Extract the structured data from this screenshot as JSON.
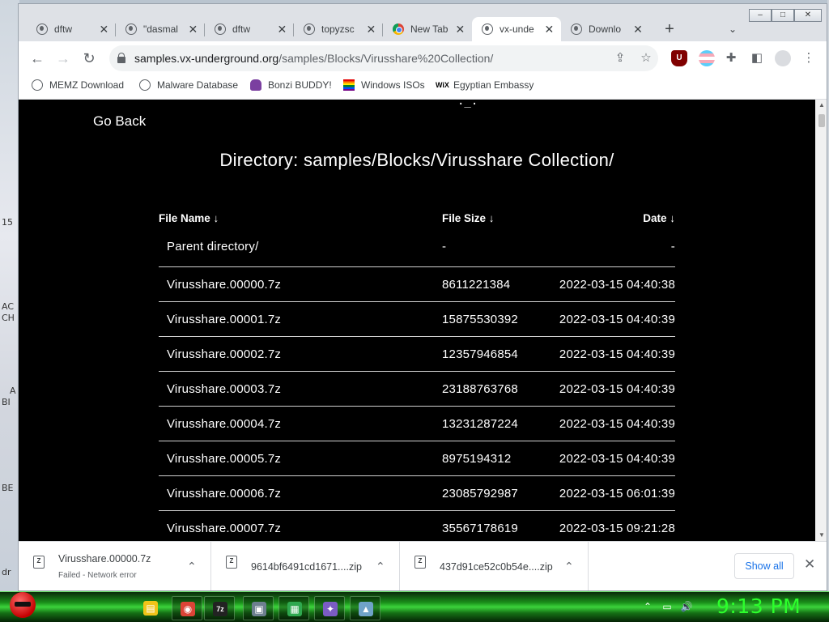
{
  "desktop": {
    "fragments": [
      "15",
      "AC",
      "CH",
      "A",
      "BI",
      "BE",
      "dr",
      "\\"
    ]
  },
  "browser": {
    "tabs": [
      {
        "title": "dftw",
        "active": false
      },
      {
        "title": "\"dasmal",
        "active": false
      },
      {
        "title": "dftw",
        "active": false
      },
      {
        "title": "topyzsc",
        "active": false
      },
      {
        "title": "New Tab",
        "active": false
      },
      {
        "title": "vx-unde",
        "active": true
      },
      {
        "title": "Downlo",
        "active": false
      }
    ],
    "new_tab_symbol": "+",
    "tab_menu_symbol": "⌄",
    "window_buttons": [
      "–",
      "□",
      "✕"
    ],
    "url": {
      "host": "samples.vx-underground.org",
      "path": "/samples/Blocks/Virusshare%20Collection/"
    },
    "bookmarks": [
      {
        "label": "MEMZ Download",
        "icon": "globe-icon"
      },
      {
        "label": "Malware Database",
        "icon": "globe-icon"
      },
      {
        "label": "Bonzi BUDDY!",
        "icon": "bonzi-icon"
      },
      {
        "label": "Windows ISOs",
        "icon": "rainbow-flag-icon"
      },
      {
        "label": "Egyptian Embassy",
        "icon": "wix-icon"
      }
    ],
    "wix_text": "WiX",
    "ublock_text": "U"
  },
  "page": {
    "ascii_fragment": "._.",
    "go_back": "Go Back",
    "heading": "Directory: samples/Blocks/Virusshare Collection/",
    "columns": {
      "name": "File Name  ↓",
      "size": "File Size  ↓",
      "date": "Date  ↓"
    },
    "parent": {
      "name": "Parent directory/",
      "size": "-",
      "date": "-"
    },
    "rows": [
      {
        "name": "Virusshare.00000.7z",
        "size": "8611221384",
        "date": "2022-03-15 04:40:38"
      },
      {
        "name": "Virusshare.00001.7z",
        "size": "15875530392",
        "date": "2022-03-15 04:40:39"
      },
      {
        "name": "Virusshare.00002.7z",
        "size": "12357946854",
        "date": "2022-03-15 04:40:39"
      },
      {
        "name": "Virusshare.00003.7z",
        "size": "23188763768",
        "date": "2022-03-15 04:40:39"
      },
      {
        "name": "Virusshare.00004.7z",
        "size": "13231287224",
        "date": "2022-03-15 04:40:39"
      },
      {
        "name": "Virusshare.00005.7z",
        "size": "8975194312",
        "date": "2022-03-15 04:40:39"
      },
      {
        "name": "Virusshare.00006.7z",
        "size": "23085792987",
        "date": "2022-03-15 06:01:39"
      },
      {
        "name": "Virusshare.00007.7z",
        "size": "35567178619",
        "date": "2022-03-15 09:21:28"
      }
    ]
  },
  "downloads": {
    "items": [
      {
        "name": "Virusshare.00000.7z",
        "status": "Failed - Network error",
        "icon_text": "Z"
      },
      {
        "name": "9614bf6491cd1671....zip",
        "status": "",
        "icon_text": "Z"
      },
      {
        "name": "437d91ce52c0b54e....zip",
        "status": "",
        "icon_text": "Z"
      }
    ],
    "show_all": "Show all",
    "close_symbol": "✕",
    "chevron_symbol": "⌃"
  },
  "taskbar": {
    "apps": [
      {
        "name": "folder-icon",
        "glyph": "▤",
        "color": "#f0c419",
        "open": false
      },
      {
        "name": "chrome-icon",
        "glyph": "◉",
        "color": "#db4437",
        "open": true
      },
      {
        "name": "7zip-icon",
        "glyph": "7z",
        "color": "#222222",
        "open": true
      },
      {
        "name": "app-window-icon",
        "glyph": "▣",
        "color": "#6d7f8f",
        "open": true
      },
      {
        "name": "tiles-icon",
        "glyph": "▦",
        "color": "#2fa84f",
        "open": true
      },
      {
        "name": "star-app-icon",
        "glyph": "✦",
        "color": "#7b5cc4",
        "open": true
      },
      {
        "name": "paint-icon",
        "glyph": "▲",
        "color": "#6fa3c9",
        "open": true
      }
    ],
    "tray": [
      "⌃",
      "▭",
      "🔊"
    ],
    "clock": "9:13 PM"
  },
  "colors": {
    "page_bg": "#000000",
    "page_text": "#ffffff",
    "link_blue": "#1a73e8",
    "clock_green": "#2cff2c"
  }
}
